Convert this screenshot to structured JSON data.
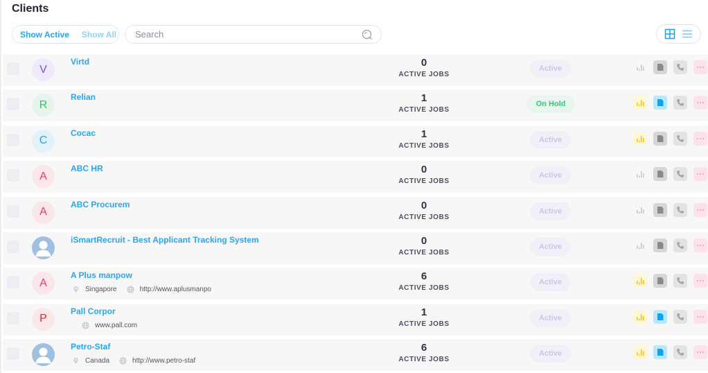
{
  "header": {
    "title": "Clients",
    "filters": {
      "show_active": "Show Active",
      "show_all": "Show All"
    },
    "search": {
      "placeholder": "Search",
      "value": ""
    },
    "view_toggle": {
      "grid": "grid-view",
      "list": "list-view"
    }
  },
  "colors": {
    "accent": "#1ea7f5",
    "link": "#2aa6ee",
    "active_badge_bg": "#f1f0f8",
    "active_badge_text": "#c9c6ea",
    "hold_badge_bg": "#e8f6ee",
    "hold_badge_text": "#3cc47a"
  },
  "clients": [
    {
      "initial": "V",
      "avatar_bg": "#efeafb",
      "avatar_fg": "#7b4fe0",
      "photo": false,
      "name": "Virtd",
      "location": "",
      "website": "",
      "active_jobs": "0",
      "jobs_label": "ACTIVE JOBS",
      "status": "Active",
      "status_type": "active",
      "chart_on": false,
      "doc_on": false
    },
    {
      "initial": "R",
      "avatar_bg": "#e6f5ec",
      "avatar_fg": "#35c46e",
      "photo": false,
      "name": "Relian",
      "location": "",
      "website": "",
      "active_jobs": "1",
      "jobs_label": "ACTIVE JOBS",
      "status": "On Hold",
      "status_type": "hold",
      "chart_on": true,
      "doc_on": true
    },
    {
      "initial": "C",
      "avatar_bg": "#e2f2fc",
      "avatar_fg": "#2a9fe8",
      "photo": false,
      "name": "Cocac",
      "location": "",
      "website": "",
      "active_jobs": "1",
      "jobs_label": "ACTIVE JOBS",
      "status": "Active",
      "status_type": "active",
      "chart_on": true,
      "doc_on": false
    },
    {
      "initial": "A",
      "avatar_bg": "#fbe6ea",
      "avatar_fg": "#ec3b63",
      "photo": false,
      "name": "ABC HR",
      "location": "",
      "website": "",
      "active_jobs": "0",
      "jobs_label": "ACTIVE JOBS",
      "status": "Active",
      "status_type": "active",
      "chart_on": false,
      "doc_on": false
    },
    {
      "initial": "A",
      "avatar_bg": "#fbe6ea",
      "avatar_fg": "#ec3b63",
      "photo": false,
      "name": "ABC Procurem",
      "location": "",
      "website": "",
      "active_jobs": "0",
      "jobs_label": "ACTIVE JOBS",
      "status": "Active",
      "status_type": "active",
      "chart_on": false,
      "doc_on": false
    },
    {
      "initial": "",
      "avatar_bg": "#9fc0e0",
      "avatar_fg": "#ffffff",
      "photo": true,
      "name": "iSmartRecruit - Best Applicant Tracking System",
      "location": "",
      "website": "",
      "active_jobs": "0",
      "jobs_label": "ACTIVE JOBS",
      "status": "Active",
      "status_type": "active",
      "chart_on": false,
      "doc_on": false
    },
    {
      "initial": "A",
      "avatar_bg": "#fbe6ea",
      "avatar_fg": "#ec3b63",
      "photo": false,
      "name": "A Plus manpow",
      "location": "Singapore",
      "website": "http://www.aplusmanpo",
      "active_jobs": "6",
      "jobs_label": "ACTIVE JOBS",
      "status": "Active",
      "status_type": "active",
      "chart_on": true,
      "doc_on": false
    },
    {
      "initial": "P",
      "avatar_bg": "#fbe6ea",
      "avatar_fg": "#e8261c",
      "photo": false,
      "name": "Pall Corpor",
      "location": "",
      "website": "www.pall.com",
      "active_jobs": "1",
      "jobs_label": "ACTIVE JOBS",
      "status": "Active",
      "status_type": "active",
      "chart_on": true,
      "doc_on": true
    },
    {
      "initial": "",
      "avatar_bg": "#9fc0e0",
      "avatar_fg": "#ffffff",
      "photo": true,
      "name": "Petro-Staf",
      "location": "Canada",
      "website": "http://www.petro-staf",
      "active_jobs": "6",
      "jobs_label": "ACTIVE JOBS",
      "status": "Active",
      "status_type": "active",
      "chart_on": true,
      "doc_on": true
    }
  ]
}
